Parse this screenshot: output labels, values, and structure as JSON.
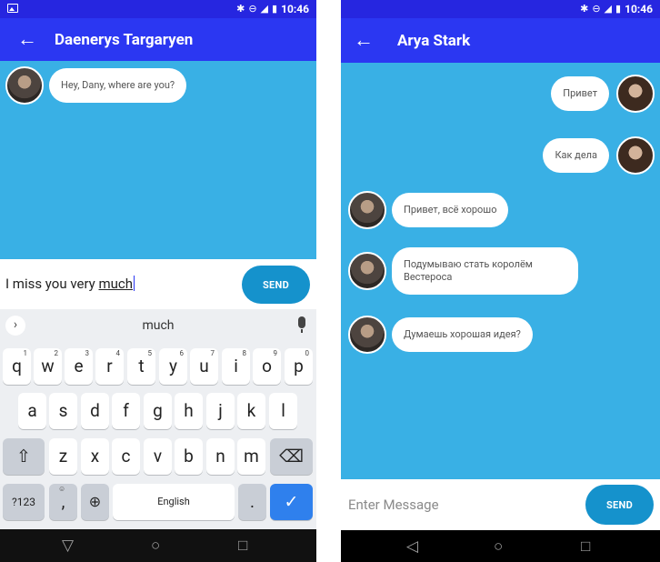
{
  "left": {
    "title": "Daenerys Targaryen",
    "time": "10:46",
    "messages": [
      {
        "text": "Hey, Dany, where are you?"
      }
    ],
    "input": {
      "prefix": "I miss you very ",
      "underlined": "much"
    },
    "send_label": "SEND",
    "keyboard": {
      "suggestion": "much",
      "row1": [
        "q",
        "w",
        "e",
        "r",
        "t",
        "y",
        "u",
        "i",
        "o",
        "p"
      ],
      "row1_sup": [
        "1",
        "2",
        "3",
        "4",
        "5",
        "6",
        "7",
        "8",
        "9",
        "0"
      ],
      "row2": [
        "a",
        "s",
        "d",
        "f",
        "g",
        "h",
        "j",
        "k",
        "l"
      ],
      "row3": [
        "z",
        "x",
        "c",
        "v",
        "b",
        "n",
        "m"
      ],
      "sym": "?123",
      "comma": ",",
      "emoji": "☺",
      "space": "English",
      "period": "."
    }
  },
  "right": {
    "title": "Arya Stark",
    "time": "10:46",
    "messages": [
      {
        "text": "Привет"
      },
      {
        "text": "Как дела"
      },
      {
        "text": "Привет, всё хорошо"
      },
      {
        "text": "Подумываю стать королём Вестероса"
      },
      {
        "text": "Думаешь хорошая идея?"
      }
    ],
    "placeholder": "Enter Message",
    "send_label": "SEND"
  },
  "colors": {
    "statusbar": "#2626e0",
    "appbar": "#2b37f2",
    "chat_bg": "#39b0e5",
    "send": "#1592cc"
  },
  "icons": [
    "back-arrow-icon",
    "bluetooth-icon",
    "dnd-icon",
    "signal-lte-icon",
    "battery-icon",
    "image-icon",
    "mic-icon",
    "shift-icon",
    "backspace-icon",
    "globe-icon",
    "check-icon",
    "nav-back-icon",
    "nav-home-icon",
    "nav-recents-icon"
  ]
}
